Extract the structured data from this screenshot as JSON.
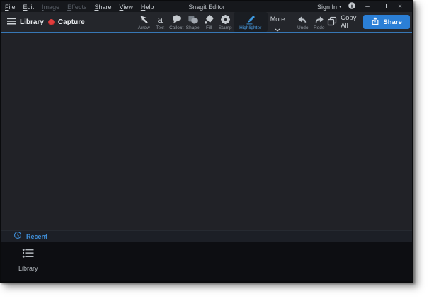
{
  "titlebar": {
    "title": "Snagit Editor",
    "menu_items": [
      {
        "label": "File",
        "enabled": true
      },
      {
        "label": "Edit",
        "enabled": true
      },
      {
        "label": "Image",
        "enabled": false
      },
      {
        "label": "Effects",
        "enabled": false
      },
      {
        "label": "Share",
        "enabled": true
      },
      {
        "label": "View",
        "enabled": true
      },
      {
        "label": "Help",
        "enabled": true
      }
    ],
    "sign_in_label": "Sign In",
    "caret_glyph": "▾",
    "window_controls": {
      "minimize_glyph": "–",
      "close_glyph": "×"
    }
  },
  "toolbar": {
    "library_label": "Library",
    "capture_label": "Capture",
    "text_tool_glyph": "a",
    "tools": [
      {
        "label": "Arrow",
        "icon": "arrow-cursor-icon",
        "selected": false
      },
      {
        "label": "Text",
        "icon": "text-icon",
        "selected": false
      },
      {
        "label": "Callout",
        "icon": "callout-icon",
        "selected": false
      },
      {
        "label": "Shape",
        "icon": "shape-icon",
        "selected": false
      },
      {
        "label": "Fill",
        "icon": "fill-icon",
        "selected": false
      },
      {
        "label": "Stamp",
        "icon": "stamp-icon",
        "selected": false
      },
      {
        "label": "Highlighter",
        "icon": "highlighter-icon",
        "selected": true
      }
    ],
    "more_label": "More",
    "undo_label": "Undo",
    "redo_label": "Redo",
    "copy_all_label": "Copy All",
    "share_label": "Share"
  },
  "recent_bar": {
    "label": "Recent",
    "icon": "clock-icon"
  },
  "tray": {
    "items": [
      {
        "label": "Library",
        "icon": "library-list-icon"
      }
    ]
  },
  "colors": {
    "accent_blue": "#2b7fd6",
    "highlight_blue": "#4ba0e8",
    "recent_blue": "#3f8fd9",
    "capture_red": "#e23c3c",
    "titlebar_bg": "#16181c",
    "toolbar_bg": "#24262b",
    "canvas_bg": "#212227",
    "tray_bg": "#0d0e12"
  }
}
